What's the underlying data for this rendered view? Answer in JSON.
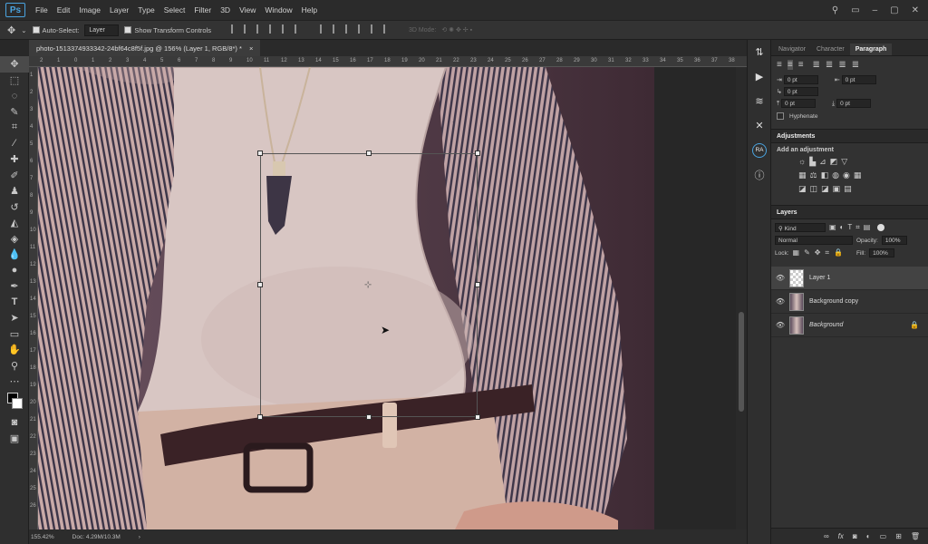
{
  "app": {
    "logo": "Ps"
  },
  "menu": [
    "File",
    "Edit",
    "Image",
    "Layer",
    "Type",
    "Select",
    "Filter",
    "3D",
    "View",
    "Window",
    "Help"
  ],
  "options": {
    "auto_select_label": "Auto-Select:",
    "auto_select_value": "Layer",
    "show_transform_label": "Show Transform Controls",
    "mode_3d_label": "3D Mode:"
  },
  "document": {
    "tab_title": "photo-1513374933342-24bf64c8f5f.jpg @ 156% (Layer 1, RGB/8*) *",
    "close_glyph": "×",
    "ruler_top": [
      "2",
      "1",
      "0",
      "1",
      "2",
      "3",
      "4",
      "5",
      "6",
      "7",
      "8",
      "9",
      "10",
      "11",
      "12",
      "13",
      "14",
      "15",
      "16",
      "17",
      "18",
      "19",
      "20",
      "21",
      "22",
      "23",
      "24",
      "25",
      "26",
      "27",
      "28",
      "29",
      "30",
      "31",
      "32",
      "33",
      "34",
      "35",
      "36",
      "37",
      "38"
    ],
    "ruler_left": [
      "1",
      "2",
      "3",
      "4",
      "5",
      "6",
      "7",
      "8",
      "9",
      "10",
      "11",
      "12",
      "13",
      "14",
      "15",
      "16",
      "17",
      "18",
      "19",
      "20",
      "21",
      "22",
      "23",
      "24",
      "25",
      "26"
    ]
  },
  "status": {
    "zoom": "155.42%",
    "doc": "Doc: 4.29M/10.3M"
  },
  "panels": {
    "top_tabs": [
      "Navigator",
      "Character",
      "Paragraph"
    ],
    "paragraph": {
      "indent_left": "0 pt",
      "indent_right": "0 pt",
      "first_line": "0 pt",
      "space_before": "0 pt",
      "space_after": "0 pt",
      "hyphenate": "Hyphenate"
    },
    "adjustments": {
      "title": "Adjustments",
      "subtitle": "Add an adjustment"
    },
    "layers": {
      "title": "Layers",
      "filter": "Kind",
      "blend_mode": "Normal",
      "opacity_label": "Opacity:",
      "opacity": "100%",
      "lock_label": "Lock:",
      "fill_label": "Fill:",
      "fill": "100%",
      "items": [
        {
          "name": "Layer 1"
        },
        {
          "name": "Background copy"
        },
        {
          "name": "Background"
        }
      ]
    }
  },
  "colors": {
    "accent": "#4aa3df",
    "panel": "#323232",
    "selected_layer": "#434343"
  }
}
